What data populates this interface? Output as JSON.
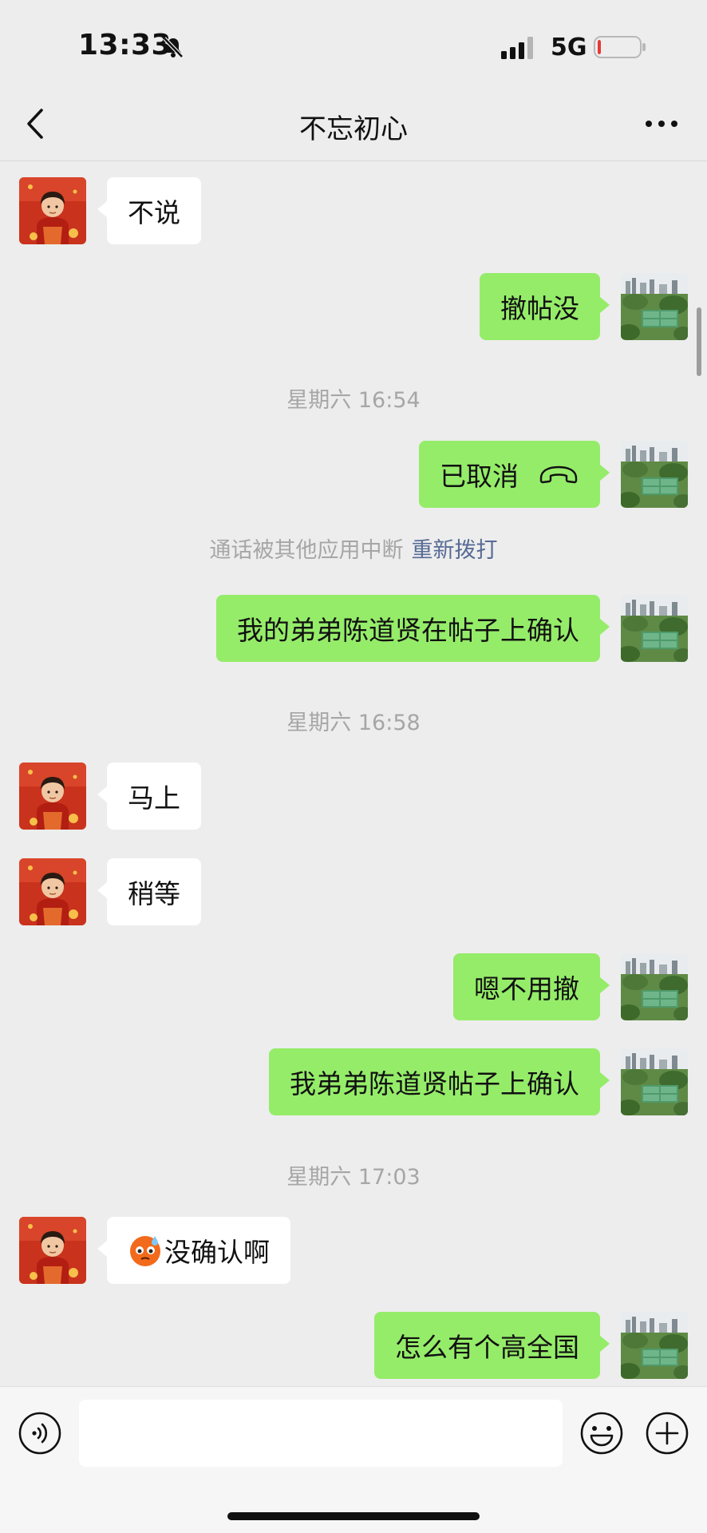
{
  "status_bar": {
    "time": "13:33",
    "network": "5G",
    "battery_level": 0.08,
    "battery_color": "#e53935",
    "icons": [
      "bell-slash-icon",
      "signal-bars-icon",
      "battery-icon"
    ]
  },
  "nav": {
    "title": "不忘初心",
    "back_icon": "chevron-left-icon",
    "more_icon": "ellipsis-icon"
  },
  "messages": [
    {
      "type": "message",
      "direction": "in",
      "text": "不说"
    },
    {
      "type": "message",
      "direction": "out",
      "text": "撤帖没"
    },
    {
      "type": "timestamp",
      "text": "星期六 16:54"
    },
    {
      "type": "call",
      "direction": "out",
      "text": "已取消",
      "icon": "hangup-phone-icon"
    },
    {
      "type": "system",
      "text": "通话被其他应用中断",
      "link": "重新拨打"
    },
    {
      "type": "message",
      "direction": "out",
      "text": "我的弟弟陈道贤在帖子上确认"
    },
    {
      "type": "timestamp",
      "text": "星期六 16:58"
    },
    {
      "type": "message",
      "direction": "in",
      "text": "马上"
    },
    {
      "type": "message",
      "direction": "in",
      "text": "稍等"
    },
    {
      "type": "message",
      "direction": "out",
      "text": "嗯不用撤"
    },
    {
      "type": "message",
      "direction": "out",
      "text": "我弟弟陈道贤帖子上确认"
    },
    {
      "type": "timestamp",
      "text": "星期六 17:03"
    },
    {
      "type": "message",
      "direction": "in",
      "text": "没确认啊",
      "emoji": "sweat-face-emoji-icon"
    },
    {
      "type": "message",
      "direction": "out",
      "text": "怎么有个高全国"
    }
  ],
  "input_bar": {
    "text": "",
    "icons": [
      "voice-icon",
      "emoji-icon",
      "plus-icon"
    ]
  },
  "colors": {
    "background": "#ededed",
    "outgoing_bubble": "#95ec69",
    "incoming_bubble": "#ffffff",
    "link": "#576b95",
    "timestamp": "#a6a6a6"
  }
}
